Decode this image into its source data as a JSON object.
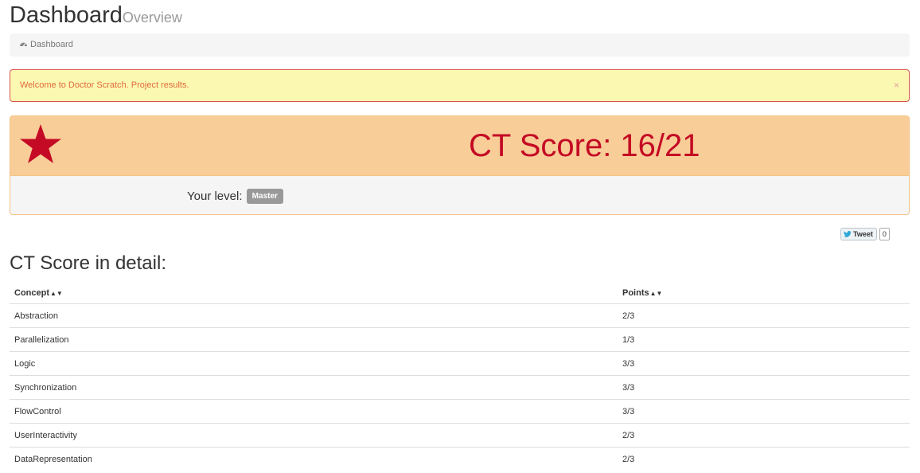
{
  "header": {
    "title": "Dashboard",
    "subtitle": "Overview"
  },
  "breadcrumb": {
    "icon": "dashboard-icon",
    "label": "Dashboard"
  },
  "alert": {
    "message": "Welcome to Doctor Scratch. Project results.",
    "close_label": "×"
  },
  "score_panel": {
    "icon": "star-icon",
    "score_text": "CT Score: 16/21",
    "level_label": "Your level:",
    "level_badge": "Master"
  },
  "tweet": {
    "button_label": "Tweet",
    "count": "0"
  },
  "detail": {
    "title": "CT Score in detail:",
    "columns": [
      "Concept",
      "Points"
    ],
    "rows": [
      {
        "concept": "Abstraction",
        "points": "2/3"
      },
      {
        "concept": "Parallelization",
        "points": "1/3"
      },
      {
        "concept": "Logic",
        "points": "3/3"
      },
      {
        "concept": "Synchronization",
        "points": "3/3"
      },
      {
        "concept": "FlowControl",
        "points": "3/3"
      },
      {
        "concept": "UserInteractivity",
        "points": "2/3"
      },
      {
        "concept": "DataRepresentation",
        "points": "2/3"
      }
    ]
  },
  "colors": {
    "alert_bg": "#fbf8b2",
    "alert_border": "#d9534f",
    "alert_text": "#e26a3c",
    "panel_heading_bg": "#f8cd98",
    "score_text": "#c40a24",
    "star": "#c40a24",
    "badge_bg": "#999999"
  }
}
